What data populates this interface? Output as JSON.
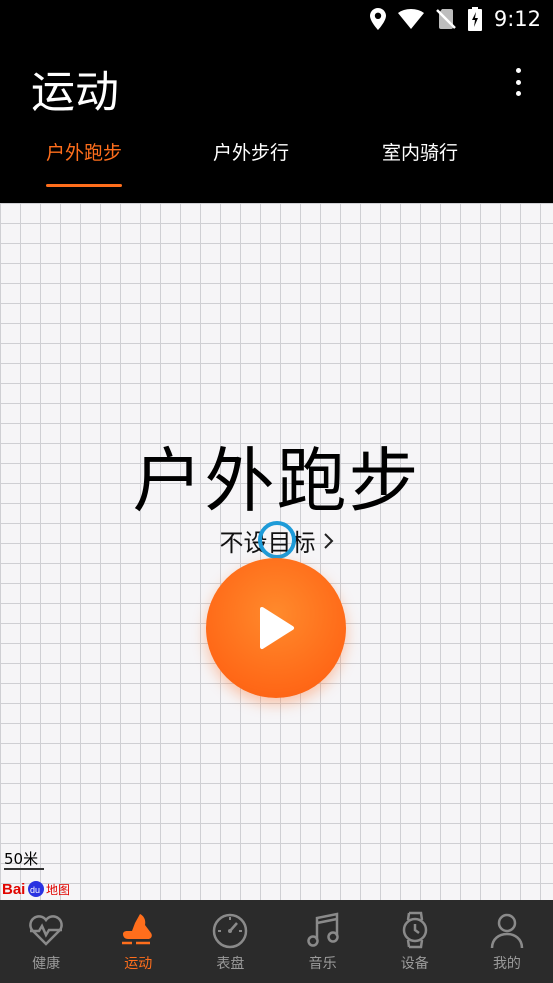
{
  "status_bar": {
    "time": "9:12"
  },
  "app_bar": {
    "title": "运动"
  },
  "tabs": [
    {
      "label": "户外跑步",
      "active": true
    },
    {
      "label": "户外步行",
      "active": false
    },
    {
      "label": "室内骑行",
      "active": false
    }
  ],
  "main": {
    "mode_title": "户外跑步",
    "goal_label": "不设目标",
    "scale_label": "50米"
  },
  "bottom_nav": [
    {
      "label": "健康",
      "icon": "heart-pulse-icon",
      "active": false
    },
    {
      "label": "运动",
      "icon": "running-shoe-icon",
      "active": true
    },
    {
      "label": "表盘",
      "icon": "dial-icon",
      "active": false
    },
    {
      "label": "音乐",
      "icon": "music-note-icon",
      "active": false
    },
    {
      "label": "设备",
      "icon": "watch-icon",
      "active": false
    },
    {
      "label": "我的",
      "icon": "person-icon",
      "active": false
    }
  ],
  "colors": {
    "accent": "#ff6e1c",
    "nav_bg": "#2b2b2b",
    "touch_ring": "#1e9bd8"
  }
}
